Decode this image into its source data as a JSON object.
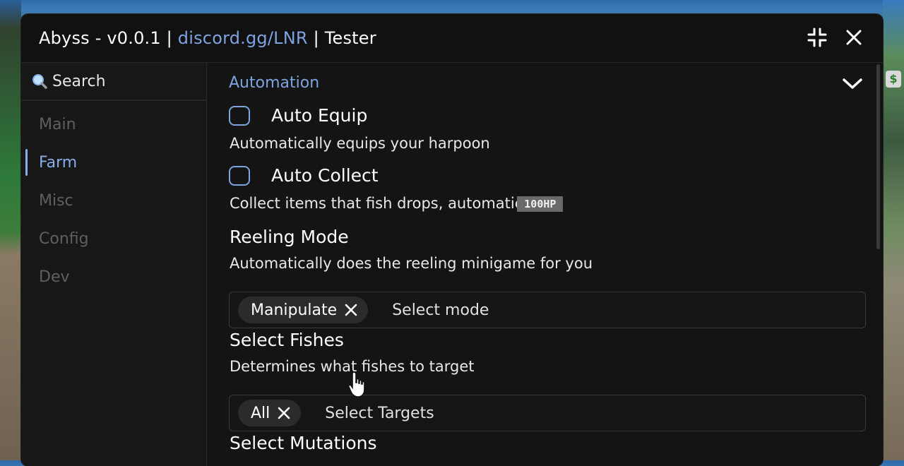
{
  "window": {
    "title_prefix": "Abyss - v0.0.1 | ",
    "title_link": "discord.gg/LNR",
    "title_suffix": " | Tester",
    "minimize_icon": "collapse-arrows-icon",
    "close_icon": "close-icon"
  },
  "sidebar": {
    "search_label": "Search",
    "items": [
      {
        "label": "Main",
        "active": false
      },
      {
        "label": "Farm",
        "active": true
      },
      {
        "label": "Misc",
        "active": false
      },
      {
        "label": "Config",
        "active": false
      },
      {
        "label": "Dev",
        "active": false
      }
    ]
  },
  "content": {
    "section_title": "Automation",
    "auto_equip": {
      "label": "Auto Equip",
      "checked": false,
      "description": "Automatically equips your harpoon"
    },
    "auto_collect": {
      "label": "Auto Collect",
      "checked": false,
      "description": "Collect items that fish drops, automatic",
      "overlay_badge": "100HP"
    },
    "reeling_mode": {
      "label": "Reeling Mode",
      "description": "Automatically does the reeling minigame for you",
      "selected_chip": "Manipulate",
      "placeholder": "Select mode"
    },
    "select_fishes": {
      "label": "Select Fishes",
      "description": "Determines what fishes to target",
      "selected_chip": "All",
      "placeholder": "Select Targets"
    },
    "select_mutations": {
      "label": "Select Mutations"
    }
  },
  "colors": {
    "accent": "#7da3e0",
    "window_bg": "#141414",
    "sidebar_bg": "#171717",
    "inactive_nav": "#5f5f5f"
  },
  "overlay": {
    "currency_symbol": "$"
  }
}
